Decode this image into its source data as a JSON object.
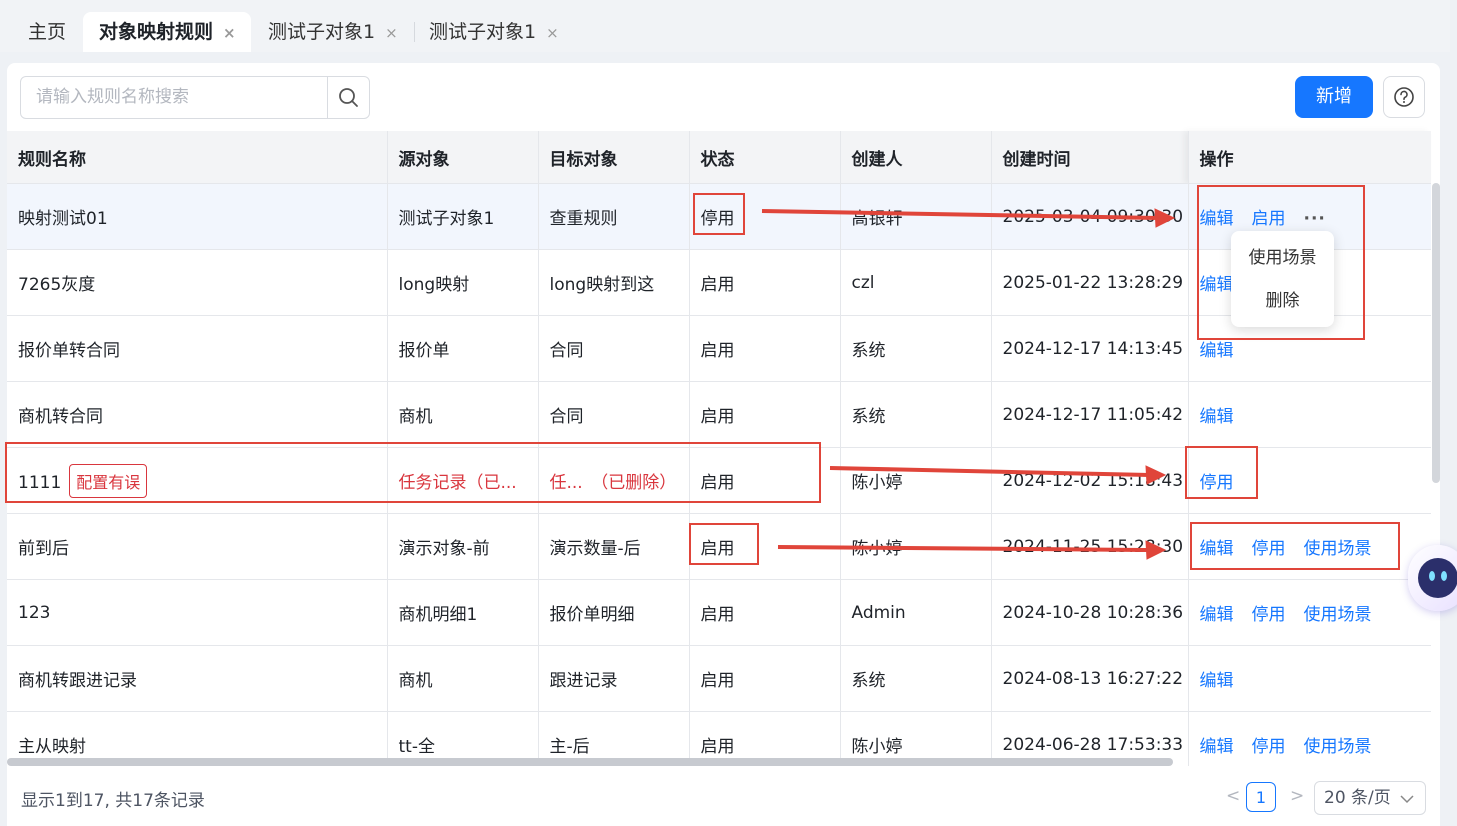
{
  "tabs": [
    {
      "label": "主页",
      "closable": false,
      "active": false
    },
    {
      "label": "对象映射规则",
      "closable": true,
      "active": true
    },
    {
      "label": "测试子对象1",
      "closable": true,
      "active": false
    },
    {
      "label": "测试子对象1",
      "closable": true,
      "active": false
    }
  ],
  "close_glyph": "×",
  "search": {
    "placeholder": "请输入规则名称搜索",
    "icon": "search-icon"
  },
  "toolbar": {
    "add_label": "新增",
    "help_icon": "help-circle-icon"
  },
  "table": {
    "columns": [
      "规则名称",
      "源对象",
      "目标对象",
      "状态",
      "创建人",
      "创建时间",
      "操作"
    ],
    "rows": [
      {
        "name": "映射测试01",
        "badge": "",
        "source": "测试子对象1",
        "target": "查重规则",
        "status": "停用",
        "creator": "高银轩",
        "created": "2025-03-04 09:30:30",
        "actions": [
          "编辑",
          "启用"
        ],
        "more": "···",
        "error": false
      },
      {
        "name": "7265灰度",
        "badge": "",
        "source": "long映射",
        "target": "long映射到这",
        "status": "启用",
        "creator": "czl",
        "created": "2025-01-22 13:28:29",
        "actions": [
          "编辑",
          "使用场景"
        ],
        "more": "",
        "error": false
      },
      {
        "name": "报价单转合同",
        "badge": "",
        "source": "报价单",
        "target": "合同",
        "status": "启用",
        "creator": "系统",
        "created": "2024-12-17 14:13:45",
        "actions": [
          "编辑"
        ],
        "more": "",
        "error": false
      },
      {
        "name": "商机转合同",
        "badge": "",
        "source": "商机",
        "target": "合同",
        "status": "启用",
        "creator": "系统",
        "created": "2024-12-17 11:05:42",
        "actions": [
          "编辑"
        ],
        "more": "",
        "error": false
      },
      {
        "name": "1111",
        "badge": "配置有误",
        "source": "任务记录（已...",
        "target": "任...　（已删除）",
        "status": "启用",
        "creator": "陈小婷",
        "created": "2024-12-02 15:18:43",
        "actions": [
          "停用"
        ],
        "more": "",
        "error": true
      },
      {
        "name": "前到后",
        "badge": "",
        "source": "演示对象-前",
        "target": "演示数量-后",
        "status": "启用",
        "creator": "陈小婷",
        "created": "2024-11-25 15:28:30",
        "actions": [
          "编辑",
          "停用",
          "使用场景"
        ],
        "more": "",
        "error": false
      },
      {
        "name": "123",
        "badge": "",
        "source": "商机明细1",
        "target": "报价单明细",
        "status": "启用",
        "creator": "Admin",
        "created": "2024-10-28 10:28:36",
        "actions": [
          "编辑",
          "停用",
          "使用场景"
        ],
        "more": "",
        "error": false
      },
      {
        "name": "商机转跟进记录",
        "badge": "",
        "source": "商机",
        "target": "跟进记录",
        "status": "启用",
        "creator": "系统",
        "created": "2024-08-13 16:27:22",
        "actions": [
          "编辑"
        ],
        "more": "",
        "error": false
      },
      {
        "name": "主从映射",
        "badge": "",
        "source": "tt-全",
        "target": "主-后",
        "status": "启用",
        "creator": "陈小婷",
        "created": "2024-06-28 17:53:33",
        "actions": [
          "编辑",
          "停用",
          "使用场景"
        ],
        "more": "",
        "error": false
      }
    ]
  },
  "dropdown": {
    "items": [
      "使用场景",
      "删除"
    ]
  },
  "footer": {
    "summary": "显示1到17, 共17条记录",
    "prev": "<",
    "current_page": "1",
    "next": ">",
    "page_size": "20 条/页"
  },
  "colors": {
    "primary": "#1677ff",
    "annotation_red": "#e0453a",
    "error_red": "#d9363e"
  }
}
